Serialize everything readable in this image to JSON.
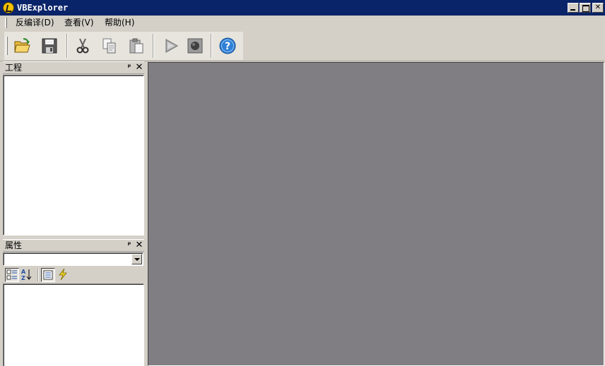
{
  "window": {
    "title": "VBExplorer",
    "icon": "vb-explorer-app-icon",
    "controls": [
      "minimize-icon",
      "maximize-icon",
      "close-icon"
    ]
  },
  "menu": {
    "items": [
      {
        "label": "反编译(D)",
        "icon": null
      },
      {
        "label": "查看(V)",
        "icon": null
      },
      {
        "label": "帮助(H)",
        "icon": null
      }
    ]
  },
  "toolbar": {
    "buttons": [
      {
        "name": "open",
        "icon": "open-folder-icon"
      },
      {
        "name": "save",
        "icon": "save-disk-icon"
      },
      {
        "name": "cut",
        "icon": "scissors-icon"
      },
      {
        "name": "copy",
        "icon": "copy-icon"
      },
      {
        "name": "paste",
        "icon": "paste-icon"
      },
      {
        "name": "run",
        "icon": "play-icon"
      },
      {
        "name": "stop",
        "icon": "stop-record-icon"
      },
      {
        "name": "help",
        "icon": "help-icon"
      }
    ]
  },
  "panels": {
    "project": {
      "title": "工程",
      "pin": "ᵖ",
      "close": "✕"
    },
    "properties": {
      "title": "属性",
      "pin": "ᵖ",
      "close": "✕",
      "combo_value": "",
      "tools": [
        "categorized-icon",
        "alphabetical-icon",
        "properties-icon",
        "events-icon"
      ]
    }
  },
  "colors": {
    "titlebar": "#0a246a",
    "chrome": "#d4d0c8",
    "mdi_background": "#807e82"
  }
}
